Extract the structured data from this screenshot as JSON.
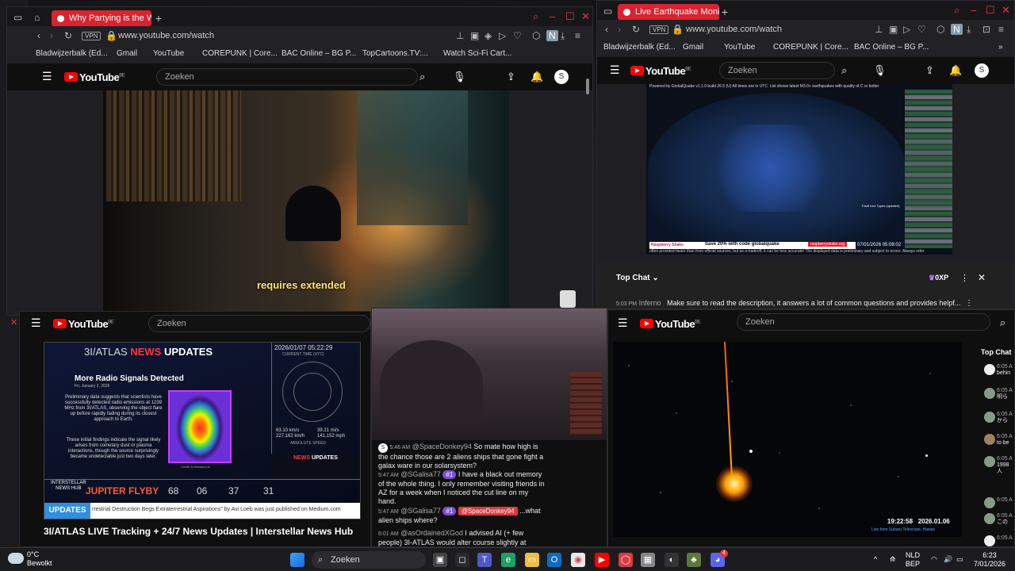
{
  "colors": {
    "opera_red": "#d9232f",
    "yt_red": "#ff0000",
    "accent_yellow": "#ffe36e",
    "heat_border": "#c83cff"
  },
  "left_browser": {
    "tab_title": "Why Partying is the W...",
    "url": "www.youtube.com/watch",
    "vpn": "VPN",
    "bookmarks": [
      "Bladwijzerbalk (Ed...",
      "Gmail",
      "YouTube",
      "COREPUNK | Core...",
      "BAC Online – BG P...",
      "TopCartoons.TV:...",
      "Watch Sci-Fi Cart..."
    ],
    "yt_logo": "YouTube",
    "yt_region": "BE",
    "search_placeholder": "Zoeken",
    "avatar": "S",
    "subtitle": "requires extended"
  },
  "right_browser": {
    "tab_title": "Live Earthquake Monitorin...",
    "url": "www.youtube.com/watch",
    "vpn": "VPN",
    "bookmarks": [
      "Bladwijzerbalk (Ed...",
      "Gmail",
      "YouTube",
      "COREPUNK | Core...",
      "BAC Online – BG P..."
    ],
    "yt_logo": "YouTube",
    "yt_region": "BE",
    "search_placeholder": "Zoeken",
    "avatar": "S",
    "map_header": "Powered by GlobalQuake v1.1.0 build 26.5 (U)    All times are in UTC. List shows latest M3.0+ earthquakes with quality of C or better",
    "map_footer": "often provided faster than from official sources, but as a tradeoff, it can be less accurate! The displayed data is preliminary and subject to errors. Always refer",
    "map_ad_brand": "Raspberry Shake",
    "map_ad_text": "Save 20% with code globalquake",
    "map_ad_url": "raspberryshake.org",
    "map_timestamp": "07/01/2026 05:08:02",
    "map_legend_title": "Fault Line Types (updated)",
    "chat_title": "Top Chat",
    "chat_points": "0XP",
    "chat_time": "5:03 PM",
    "chat_author": "Inferno",
    "chat_message": "Make sure to read the description, it answers a lot of common questions and provides helpf..."
  },
  "bottom_left": {
    "yt_logo": "YouTube",
    "yt_region": "BE",
    "search_placeholder": "Zoeken",
    "thumb_brand": "3I/ATLAS",
    "thumb_news": "NEWS",
    "thumb_updates": "UPDATES",
    "thumb_headline": "More Radio Signals Detected",
    "thumb_date": "Fri, January 2, 2026",
    "thumb_body1": "Preliminary data suggests that scientists have successfully detected radio emissions at 1239 MHz from 3I/ATLAS, observing the object flare up before rapidly fading during its closest approach to Earth.",
    "thumb_body2": "These initial findings indicate the signal likely arises from cometary dust or plasma interactions, though the source surprisingly became undetectable just two days later.",
    "thumb_credit": "Credit: A.Hamaoui.ai",
    "clock_date": "2026/01/07 05:22:29",
    "clock_label": "CURRENT TIME (UTC)",
    "speed1": "63.10 km/s",
    "speed1b": "227,162 km/h",
    "speed2": "39.21 mi/s",
    "speed2b": "141,152 mph",
    "speed_label": "ABSOLUTE SPEED",
    "flyby_label": "JUPITER FLYBY",
    "countdown": [
      "68",
      "06",
      "37",
      "31"
    ],
    "ticker_label": "UPDATES",
    "ticker_text": "rrestrial Destruction Begs Extraterrestrial Aspirations\" by Avi Loeb was just published on Medium.com",
    "inh_name": "INTERSTELLAR",
    "inh_sub": "NEWS HUB",
    "video_title": "3I/ATLAS LIVE Tracking + 24/7 News Updates | Interstellar News Hub"
  },
  "bottom_middle": {
    "messages": [
      {
        "time": "5:46 AM",
        "author": "@SpaceDonkey94",
        "text": "So mate how high is the chance those are 2 aliens ships that gone fight a galax ware in our solarsystem?"
      },
      {
        "time": "5:47 AM",
        "author": "@SGalisa77",
        "badge": "#1",
        "text": "I have a black out memory of the whole thing. I only remember visiting friends in AZ for a week when I noticed the cut line on my hand."
      },
      {
        "time": "5:47 AM",
        "author": "@SGalisa77",
        "badge": "#1",
        "mention": "@SpaceDonkey94",
        "text": "...what alien ships where?"
      },
      {
        "time": "6:01 AM",
        "author": "@asOrdainedXGod",
        "text": "I advised AI (+ few people) 3I-ATLAS would alter course slightly at perihelion. Jupiter Flyby..."
      }
    ]
  },
  "bottom_right": {
    "yt_logo": "YouTube",
    "yt_region": "BE",
    "search_placeholder": "Zoeken",
    "overlay_time": "19:22:58",
    "overlay_date": "2026.01.06",
    "overlay_source": "Live from Subaru Telescope, Hawaii",
    "chat_title": "Top Chat",
    "chat_times": [
      "6:05 A",
      "6:05 A",
      "6:05 A",
      "6:05 A",
      "6:05 A",
      "6:05 A",
      "6:05 A",
      "6:05 A",
      "6:05 A"
    ],
    "chat_snippets": [
      "behin",
      "明ら",
      "から",
      "to be",
      "1998",
      "人",
      "",
      "この",
      ""
    ]
  },
  "taskbar": {
    "weather_temp": "0°C",
    "weather_desc": "Bewolkt",
    "search_label": "Zoeken",
    "lang": "NLD",
    "lang2": "BEP",
    "time": "6:23",
    "date": "7/01/2026",
    "discord_badge": "4"
  }
}
